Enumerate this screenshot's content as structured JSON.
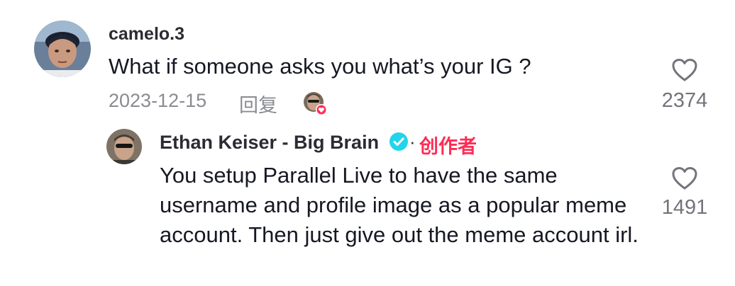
{
  "comment": {
    "username": "camelo.3",
    "text": "What if someone asks you what’s your IG ?",
    "date": "2023-12-15",
    "reply_label": "回复",
    "like_count": "2374",
    "icons": {
      "avatar": "user-avatar",
      "creator_liked": "creator-liked-badge-icon",
      "like": "heart-outline-icon"
    }
  },
  "reply": {
    "username": "Ethan Keiser - Big Brain",
    "separator": "·",
    "creator_tag": "创作者",
    "text": "You setup Parallel Live to have the same username and profile image as a popular meme account. Then just give out the meme account irl.",
    "like_count": "1491",
    "icons": {
      "avatar": "user-avatar",
      "verified": "verified-badge-icon",
      "like": "heart-outline-icon"
    }
  },
  "colors": {
    "creator_tag": "#fe2c55",
    "verified": "#20d5ec",
    "muted_text": "#8a8b91"
  }
}
